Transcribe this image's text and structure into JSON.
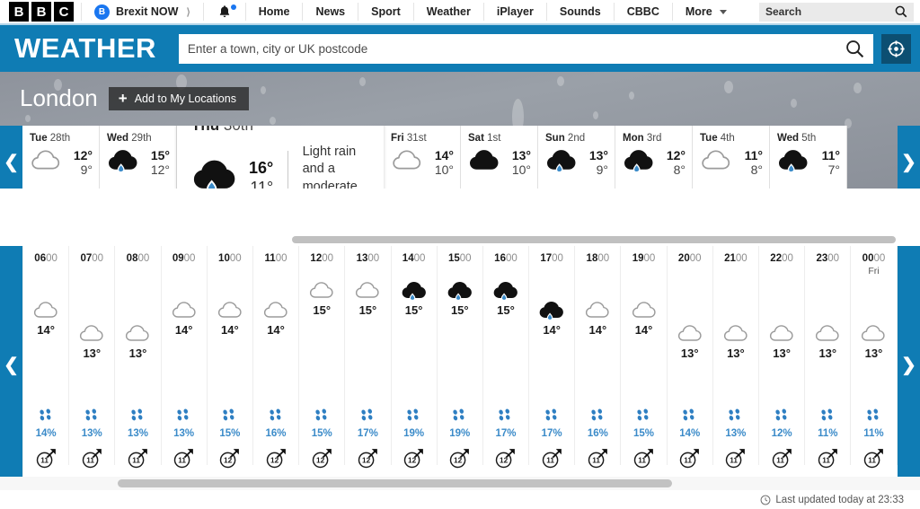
{
  "global_nav": {
    "logo_letters": [
      "B",
      "B",
      "C"
    ],
    "promo": {
      "badge": "B",
      "label": "Brexit NOW"
    },
    "notifications_icon": "bell-icon",
    "items": [
      "Home",
      "News",
      "Sport",
      "Weather",
      "iPlayer",
      "Sounds",
      "CBBC",
      "More"
    ],
    "search_placeholder": "Search",
    "search_icon": "search-icon"
  },
  "masthead": {
    "title": "WEATHER",
    "search_placeholder": "Enter a town, city or UK postcode",
    "search_icon": "search-icon",
    "location_icon": "crosshair-location-icon"
  },
  "hero": {
    "city": "London",
    "add_button_label": "Add to My Locations",
    "add_button_icon": "plus-icon"
  },
  "day_nav": {
    "prev_icon": "chevron-left-icon",
    "next_icon": "chevron-right-icon"
  },
  "days": [
    {
      "day": "Tue",
      "date": "28th",
      "icon": "cloudy",
      "high": "12°",
      "low": "9°",
      "bar": "#f9b415",
      "selected": false
    },
    {
      "day": "Wed",
      "date": "29th",
      "icon": "light-rain",
      "high": "15°",
      "low": "12°",
      "bar": "#ef9d12",
      "selected": false
    },
    {
      "day": "Thu",
      "date": "30th",
      "icon": "light-rain",
      "high": "16°",
      "low": "11°",
      "bar": "#f9b415",
      "selected": true,
      "description": "Light rain and a moderate breeze"
    },
    {
      "day": "Fri",
      "date": "31st",
      "icon": "cloudy",
      "high": "14°",
      "low": "10°",
      "bar": "#f9b415",
      "selected": false
    },
    {
      "day": "Sat",
      "date": "1st",
      "icon": "cloudy-dark",
      "high": "13°",
      "low": "10°",
      "bar": "#fbc423",
      "selected": false
    },
    {
      "day": "Sun",
      "date": "2nd",
      "icon": "light-rain",
      "high": "13°",
      "low": "9°",
      "bar": "#fbc423",
      "selected": false
    },
    {
      "day": "Mon",
      "date": "3rd",
      "icon": "light-rain",
      "high": "12°",
      "low": "8°",
      "bar": "#fbc423",
      "selected": false
    },
    {
      "day": "Tue",
      "date": "4th",
      "icon": "cloudy",
      "high": "11°",
      "low": "8°",
      "bar": "#fbc423",
      "selected": false
    },
    {
      "day": "Wed",
      "date": "5th",
      "icon": "light-rain",
      "high": "11°",
      "low": "7°",
      "bar": "#fbc423",
      "selected": false
    }
  ],
  "hourly": [
    {
      "hour_bold": "06",
      "hour_light": "00",
      "sub": "",
      "icon": "cloudy",
      "temp": "14°",
      "precip": "14%",
      "wind": "11"
    },
    {
      "hour_bold": "07",
      "hour_light": "00",
      "sub": "",
      "icon": "cloudy",
      "temp": "13°",
      "precip": "13%",
      "wind": "11"
    },
    {
      "hour_bold": "08",
      "hour_light": "00",
      "sub": "",
      "icon": "cloudy",
      "temp": "13°",
      "precip": "13%",
      "wind": "11"
    },
    {
      "hour_bold": "09",
      "hour_light": "00",
      "sub": "",
      "icon": "cloudy",
      "temp": "14°",
      "precip": "13%",
      "wind": "11"
    },
    {
      "hour_bold": "10",
      "hour_light": "00",
      "sub": "",
      "icon": "cloudy",
      "temp": "14°",
      "precip": "15%",
      "wind": "12"
    },
    {
      "hour_bold": "11",
      "hour_light": "00",
      "sub": "",
      "icon": "cloudy",
      "temp": "14°",
      "precip": "16%",
      "wind": "12"
    },
    {
      "hour_bold": "12",
      "hour_light": "00",
      "sub": "",
      "icon": "cloudy",
      "temp": "15°",
      "precip": "15%",
      "wind": "12"
    },
    {
      "hour_bold": "13",
      "hour_light": "00",
      "sub": "",
      "icon": "cloudy",
      "temp": "15°",
      "precip": "17%",
      "wind": "12"
    },
    {
      "hour_bold": "14",
      "hour_light": "00",
      "sub": "",
      "icon": "light-rain",
      "temp": "15°",
      "precip": "19%",
      "wind": "12"
    },
    {
      "hour_bold": "15",
      "hour_light": "00",
      "sub": "",
      "icon": "light-rain",
      "temp": "15°",
      "precip": "19%",
      "wind": "12"
    },
    {
      "hour_bold": "16",
      "hour_light": "00",
      "sub": "",
      "icon": "light-rain",
      "temp": "15°",
      "precip": "17%",
      "wind": "12"
    },
    {
      "hour_bold": "17",
      "hour_light": "00",
      "sub": "",
      "icon": "light-rain",
      "temp": "14°",
      "precip": "17%",
      "wind": "11"
    },
    {
      "hour_bold": "18",
      "hour_light": "00",
      "sub": "",
      "icon": "cloudy",
      "temp": "14°",
      "precip": "16%",
      "wind": "11"
    },
    {
      "hour_bold": "19",
      "hour_light": "00",
      "sub": "",
      "icon": "cloudy",
      "temp": "14°",
      "precip": "15%",
      "wind": "11"
    },
    {
      "hour_bold": "20",
      "hour_light": "00",
      "sub": "",
      "icon": "cloudy",
      "temp": "13°",
      "precip": "14%",
      "wind": "11"
    },
    {
      "hour_bold": "21",
      "hour_light": "00",
      "sub": "",
      "icon": "cloudy",
      "temp": "13°",
      "precip": "13%",
      "wind": "11"
    },
    {
      "hour_bold": "22",
      "hour_light": "00",
      "sub": "",
      "icon": "cloudy",
      "temp": "13°",
      "precip": "12%",
      "wind": "11"
    },
    {
      "hour_bold": "23",
      "hour_light": "00",
      "sub": "",
      "icon": "cloudy",
      "temp": "13°",
      "precip": "11%",
      "wind": "11"
    },
    {
      "hour_bold": "00",
      "hour_light": "00",
      "sub": "Fri",
      "icon": "cloudy",
      "temp": "13°",
      "precip": "11%",
      "wind": "11"
    }
  ],
  "footer": {
    "clock_icon": "clock-icon",
    "last_updated": "Last updated today at 23:33"
  },
  "colors": {
    "bbc_blue": "#0f7cb4",
    "dark_blue": "#0c4f72",
    "accent_yellow": "#f9b415",
    "rain_blue": "#3b8bc9"
  }
}
